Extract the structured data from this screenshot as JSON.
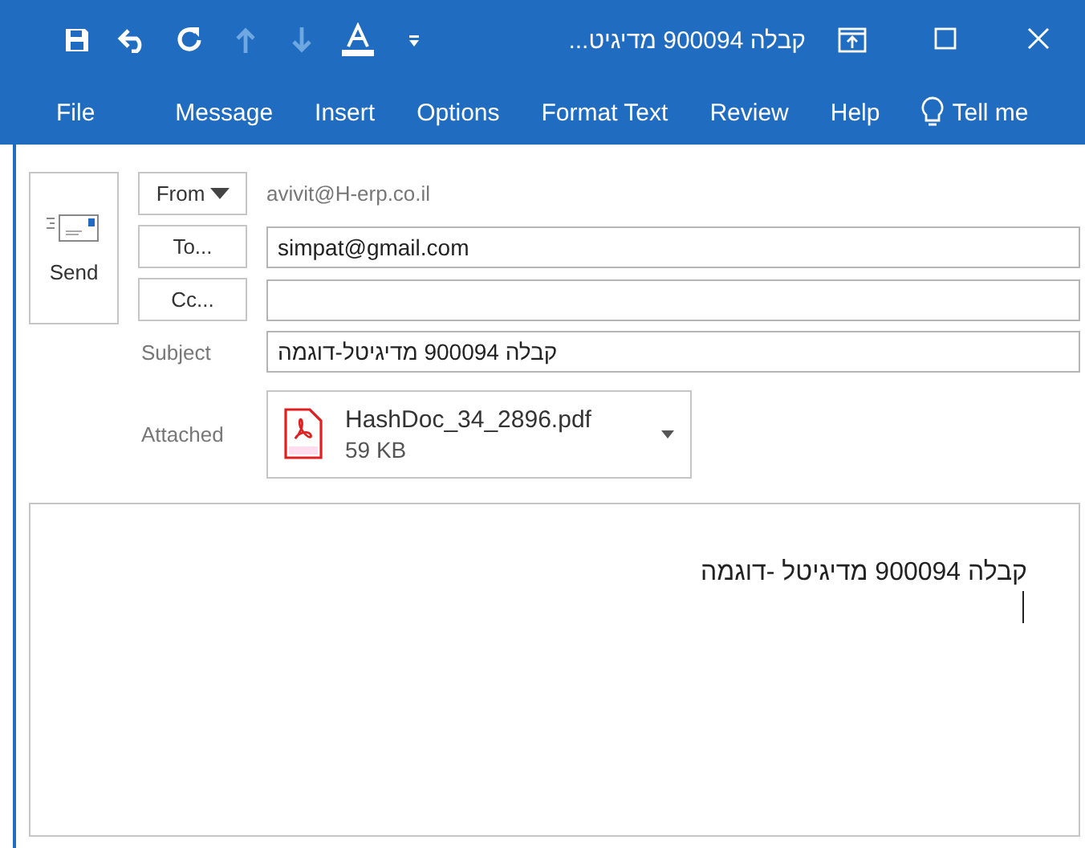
{
  "window": {
    "title": "קבלה 900094 מדיגיט..."
  },
  "quick_access": [
    {
      "kind": "save",
      "disabled": false
    },
    {
      "kind": "undo",
      "disabled": false
    },
    {
      "kind": "redo",
      "disabled": false
    },
    {
      "kind": "up",
      "disabled": true
    },
    {
      "kind": "down",
      "disabled": true
    },
    {
      "kind": "font-color",
      "disabled": false
    },
    {
      "kind": "more",
      "disabled": false
    }
  ],
  "ribbon_tabs": [
    {
      "label": "File"
    },
    {
      "label": "Message"
    },
    {
      "label": "Insert"
    },
    {
      "label": "Options"
    },
    {
      "label": "Format Text"
    },
    {
      "label": "Review"
    },
    {
      "label": "Help"
    },
    {
      "label": "Tell me",
      "kind": "tell"
    }
  ],
  "send": {
    "label": "Send"
  },
  "from": {
    "label": "From",
    "value": "avivit@H-erp.co.il"
  },
  "to": {
    "label": "To...",
    "value": "simpat@gmail.com"
  },
  "cc": {
    "label": "Cc..."
  },
  "subject": {
    "label": "Subject",
    "value": "קבלה 900094 מדיגיטל-דוגמה"
  },
  "attached": {
    "label": "Attached",
    "file": {
      "name": "HashDoc_34_2896.pdf",
      "size": "59 KB"
    }
  },
  "body": {
    "text": "קבלה 900094 מדיגיטל -דוגמה"
  }
}
